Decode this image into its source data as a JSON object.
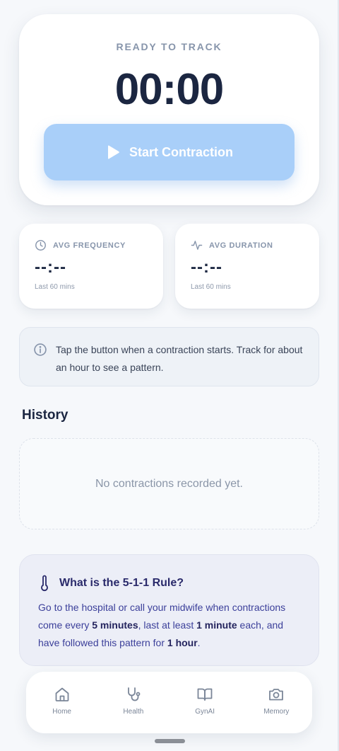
{
  "timer": {
    "status": "READY TO TRACK",
    "value": "00:00",
    "start_label": "Start Contraction"
  },
  "stats": {
    "frequency": {
      "label": "AVG FREQUENCY",
      "value": "--:--",
      "sub": "Last 60 mins"
    },
    "duration": {
      "label": "AVG DURATION",
      "value": "--:--",
      "sub": "Last 60 mins"
    }
  },
  "info": {
    "text": "Tap the button when a contraction starts. Track for about an hour to see a pattern."
  },
  "history": {
    "title": "History",
    "empty_text": "No contractions recorded yet."
  },
  "rule": {
    "title": "What is the 5-1-1 Rule?",
    "text_1": "Go to the hospital or call your midwife when contractions come every ",
    "bold_1": "5 minutes",
    "text_2": ", last at least ",
    "bold_2": "1 minute",
    "text_3": " each, and have followed this pattern for ",
    "bold_3": "1 hour",
    "text_4": "."
  },
  "nav": {
    "items": [
      {
        "label": "Home",
        "icon": "home-icon"
      },
      {
        "label": "Health",
        "icon": "stethoscope-icon"
      },
      {
        "label": "GynAI",
        "icon": "book-icon"
      },
      {
        "label": "Memory",
        "icon": "camera-icon"
      }
    ]
  },
  "colors": {
    "accent_button": "#a9cff9",
    "rule_text": "#3b3f9a",
    "background": "#f6f8fb"
  }
}
